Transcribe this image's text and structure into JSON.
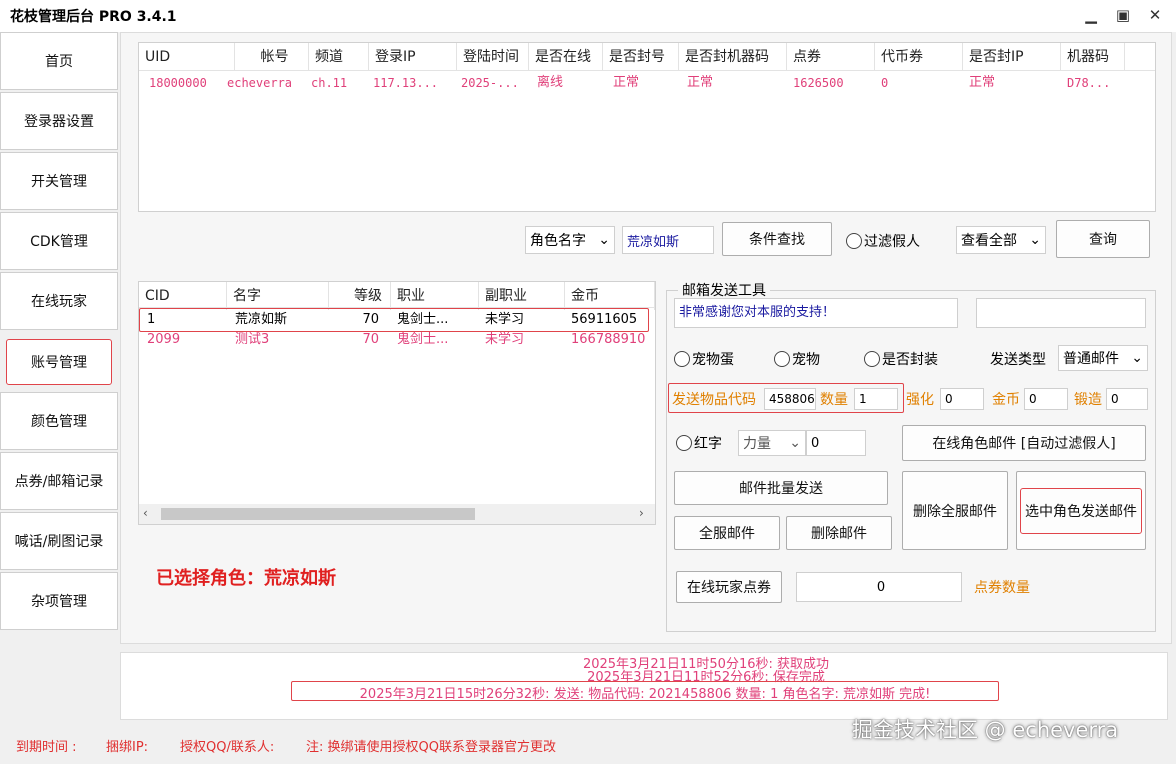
{
  "window": {
    "title": "花枝管理后台 PRO 3.4.1",
    "minimize": "▁",
    "maximize": "▣",
    "close": "✕"
  },
  "sidebar": [
    {
      "label": "首页"
    },
    {
      "label": "登录器设置"
    },
    {
      "label": "开关管理"
    },
    {
      "label": "CDK管理"
    },
    {
      "label": "在线玩家"
    },
    {
      "label": "账号管理"
    },
    {
      "label": "颜色管理"
    },
    {
      "label": "点券/邮箱记录"
    },
    {
      "label": "喊话/刷图记录"
    },
    {
      "label": "杂项管理"
    }
  ],
  "accounts": {
    "headers": [
      "UID",
      "帐号",
      "频道",
      "登录IP",
      "登陆时间",
      "是否在线",
      "是否封号",
      "是否封机器码",
      "点券",
      "代币券",
      "是否封IP",
      "机器码"
    ],
    "row": [
      "18000000",
      "echeverra",
      "ch.11",
      "117.13...",
      "2025-...",
      "离线",
      "正常",
      "正常",
      "1626500",
      "0",
      "正常",
      "D78..."
    ]
  },
  "search": {
    "field_select": "角色名字",
    "keyword": "荒凉如斯",
    "cond_button": "条件查找",
    "filter_fake": "过滤假人",
    "view_select": "查看全部",
    "query_button": "查询"
  },
  "characters": {
    "headers": [
      "CID",
      "名字",
      "等级",
      "职业",
      "副职业",
      "金币"
    ],
    "rows": [
      [
        "1",
        "荒凉如斯",
        "70",
        "鬼剑士...",
        "未学习",
        "56911605"
      ],
      [
        "2099",
        "测试3",
        "70",
        "鬼剑士...",
        "未学习",
        "166788910"
      ]
    ]
  },
  "selected_role_text": "已选择角色：荒凉如斯",
  "mail": {
    "group_title": "邮箱发送工具",
    "message": "非常感谢您对本服的支持！",
    "extra": "",
    "radio_pet_egg": "宠物蛋",
    "radio_pet": "宠物",
    "radio_sealed": "是否封装",
    "send_type_label": "发送类型",
    "send_type": "普通邮件",
    "item_code_label": "发送物品代码",
    "item_code": "458806",
    "qty_label": "数量",
    "qty": "1",
    "enhance_label": "强化",
    "enhance": "0",
    "gold_label": "金币",
    "gold": "0",
    "forge_label": "锻造",
    "forge": "0",
    "red_label": "红字",
    "red_select": "力量",
    "red_value": "0",
    "online_mail_btn": "在线角色邮件 [自动过滤假人]",
    "batch_btn": "邮件批量发送",
    "all_server_btn": "全服邮件",
    "delete_btn": "删除邮件",
    "delete_all_btn": "删除全服邮件",
    "send_selected_btn": "选中角色发送邮件",
    "online_points_btn": "在线玩家点券",
    "points_value": "0",
    "points_label": "点券数量"
  },
  "logs": [
    "2025年3月21日11时50分16秒: 获取成功",
    "2025年3月21日11时52分6秒: 保存完成",
    "2025年3月21日15时26分32秒: 发送:  物品代码: 2021458806  数量: 1  角色名字: 荒凉如斯  完成!"
  ],
  "status": {
    "expire": "到期时间 :",
    "bind_ip": "捆绑IP:",
    "qq": "授权QQ/联系人:",
    "note": "注: 换绑请使用授权QQ联系登录器官方更改"
  },
  "watermark": "掘金技术社区 @ echeverra"
}
